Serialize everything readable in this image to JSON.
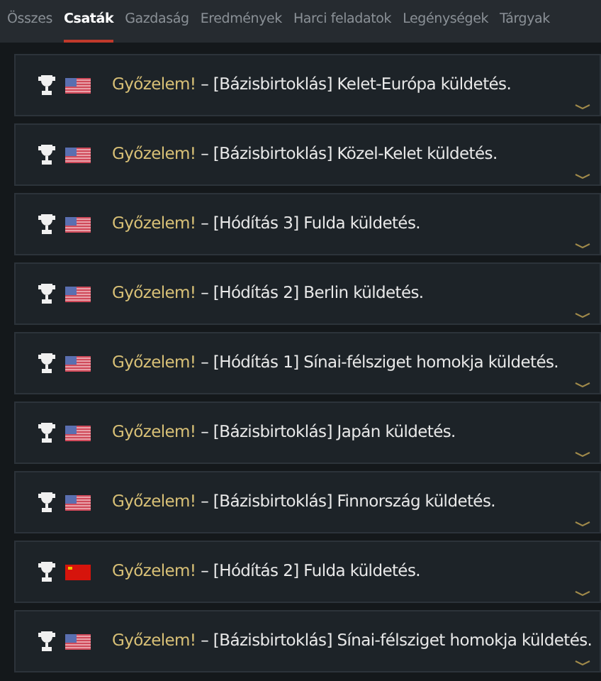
{
  "tabs": [
    {
      "label": "Összes",
      "selected": false
    },
    {
      "label": "Csaták",
      "selected": true
    },
    {
      "label": "Gazdaság",
      "selected": false
    },
    {
      "label": "Eredmények",
      "selected": false
    },
    {
      "label": "Harci feladatok",
      "selected": false
    },
    {
      "label": "Legénységek",
      "selected": false
    },
    {
      "label": "Tárgyak",
      "selected": false
    }
  ],
  "entries": [
    {
      "kind": "usa",
      "result": "Győzelem!",
      "text": "– [Bázisbirtoklás] Kelet-Európa küldetés."
    },
    {
      "kind": "usa",
      "result": "Győzelem!",
      "text": "– [Bázisbirtoklás] Közel-Kelet küldetés."
    },
    {
      "kind": "usa",
      "result": "Győzelem!",
      "text": "– [Hódítás 3] Fulda küldetés."
    },
    {
      "kind": "usa",
      "result": "Győzelem!",
      "text": "– [Hódítás 2] Berlin küldetés."
    },
    {
      "kind": "usa",
      "result": "Győzelem!",
      "text": "– [Hódítás 1] Sínai-félsziget homokja küldetés."
    },
    {
      "kind": "usa",
      "result": "Győzelem!",
      "text": "– [Bázisbirtoklás] Japán küldetés."
    },
    {
      "kind": "usa",
      "result": "Győzelem!",
      "text": "– [Bázisbirtoklás] Finnország küldetés."
    },
    {
      "kind": "ussr",
      "result": "Győzelem!",
      "text": "– [Hódítás 2] Fulda küldetés."
    },
    {
      "kind": "usa",
      "result": "Győzelem!",
      "text": "– [Bázisbirtoklás] Sínai-félsziget homokja küldetés."
    }
  ]
}
